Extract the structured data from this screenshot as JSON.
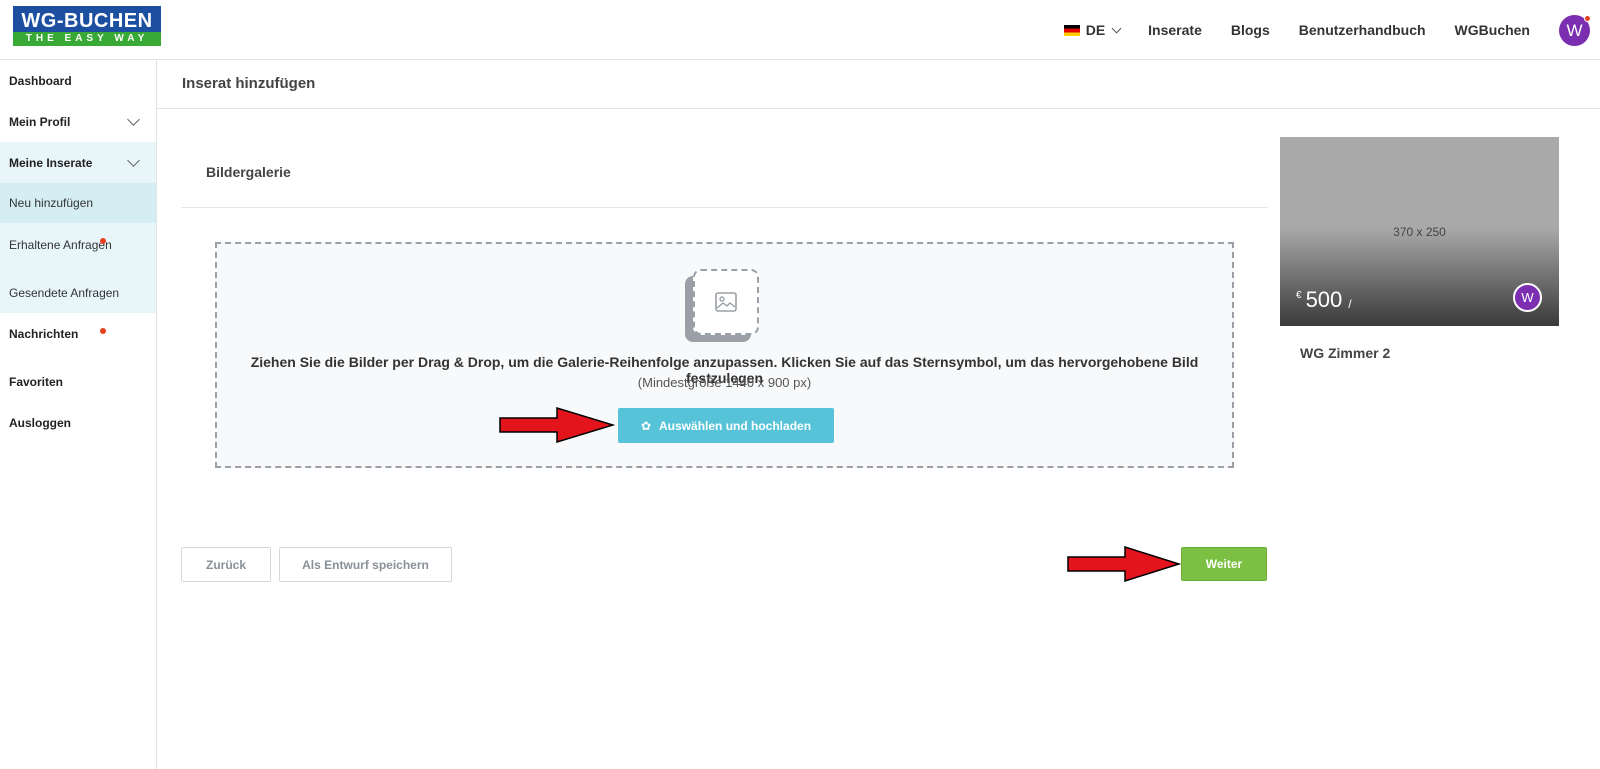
{
  "brand": {
    "name": "WG-BUCHEN",
    "tagline": "THE EASY WAY"
  },
  "header": {
    "language": "DE",
    "links": [
      "Inserate",
      "Blogs",
      "Benutzerhandbuch",
      "WGBuchen"
    ],
    "avatar_letter": "W"
  },
  "sidebar": {
    "dashboard": "Dashboard",
    "profile": "Mein Profil",
    "listings": "Meine Inserate",
    "add_new": "Neu hinzufügen",
    "received": "Erhaltene Anfragen",
    "sent": "Gesendete Anfragen",
    "messages": "Nachrichten",
    "favorites": "Favoriten",
    "logout": "Ausloggen"
  },
  "main": {
    "page_title": "Inserat hinzufügen",
    "section_title": "Bildergalerie",
    "dropzone": {
      "instruction": "Ziehen Sie die Bilder per Drag & Drop, um die Galerie-Reihenfolge anzupassen. Klicken Sie auf das Sternsymbol, um das hervorgehobene Bild festzulegen",
      "min_size": "(Mindestgröße 1440 x 900 px)",
      "upload_label": "Auswählen und hochladen"
    },
    "back_label": "Zurück",
    "draft_label": "Als Entwurf speichern",
    "next_label": "Weiter"
  },
  "preview": {
    "dimensions": "370 x 250",
    "currency": "€",
    "price": "500",
    "price_suffix": "/",
    "avatar_letter": "W",
    "title": "WG Zimmer 2"
  },
  "colors": {
    "accent_blue": "#57c3d8",
    "next_green": "#7bc043",
    "avatar_purple": "#7b2fb0",
    "notification_red": "#e8401c",
    "annotation_arrow": "#e3141b"
  }
}
